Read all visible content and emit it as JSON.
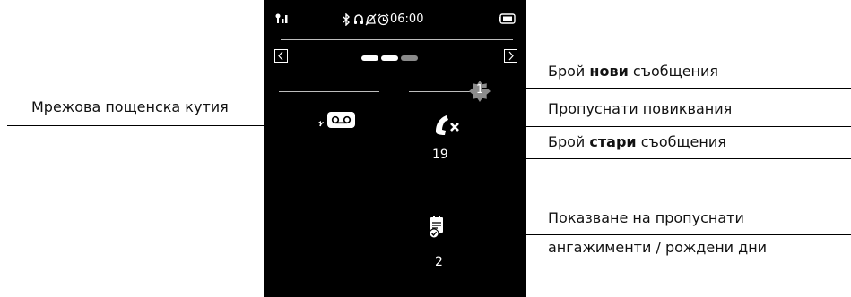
{
  "status_bar": {
    "icons": [
      "signal-icon",
      "bluetooth-icon",
      "headset-icon",
      "ringer-off-icon",
      "alarm-clock-icon",
      "battery-icon"
    ],
    "time": "06:00"
  },
  "page_indicator": {
    "pages": 3,
    "active_page": 2
  },
  "widgets": {
    "network_mailbox": {
      "icon": "network-mailbox-icon"
    },
    "missed_calls": {
      "icon": "missed-call-icon",
      "new_count": "1",
      "old_count": "19"
    },
    "missed_appointments": {
      "icon": "appointment-icon",
      "count": "2"
    }
  },
  "labels": {
    "new_messages_prefix": "Брой ",
    "new_messages_bold": "нови",
    "new_messages_suffix": " съобщения",
    "missed_calls": "Пропуснати повиквания",
    "old_messages_prefix": "Брой ",
    "old_messages_bold": "стари",
    "old_messages_suffix": " съобщения",
    "network_mailbox": "Мрежова пощенска кутия",
    "missed_appointments_line1": "Показване на пропуснати",
    "missed_appointments_line2": "ангажименти / рождени дни"
  },
  "colors": {
    "screen": "#000000",
    "badge": "#8c8c8c",
    "dot_active": "#ffffff",
    "dot_inactive": "#8a8a8a"
  }
}
